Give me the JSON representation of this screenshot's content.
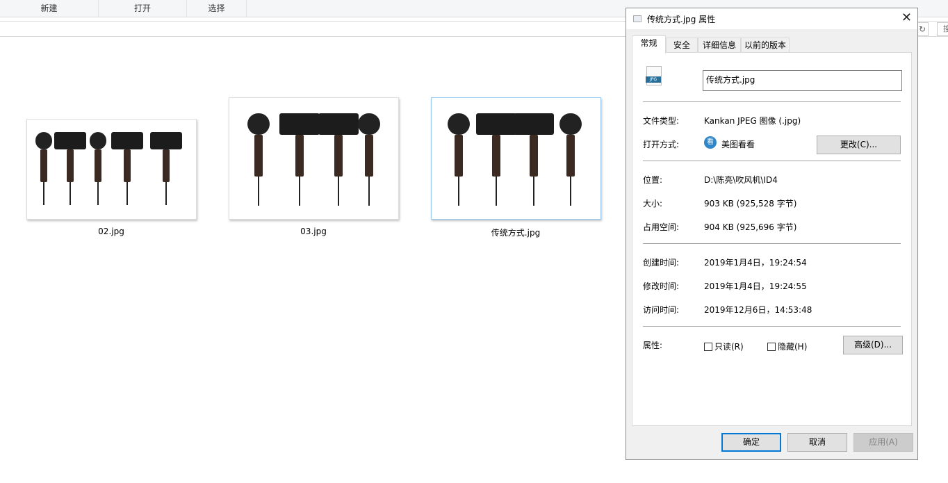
{
  "ribbon": {
    "new": "新建",
    "open": "打开",
    "select": "选择"
  },
  "search_hint": "搜",
  "files": [
    {
      "name": "02.jpg"
    },
    {
      "name": "03.jpg"
    },
    {
      "name": "传统方式.jpg"
    }
  ],
  "dialog": {
    "title": "传统方式.jpg 属性",
    "tabs": [
      "常规",
      "安全",
      "详细信息",
      "以前的版本"
    ],
    "active_tab": "常规",
    "file_icon_label": "JPG",
    "filename": "传统方式.jpg",
    "type_label": "文件类型:",
    "type_value": "Kankan JPEG 图像 (.jpg)",
    "open_label": "打开方式:",
    "open_value": "美图看看",
    "change_button": "更改(C)...",
    "location_label": "位置:",
    "location_value": "D:\\陈亮\\吹风机\\ID4",
    "size_label": "大小:",
    "size_value": "903 KB (925,528 字节)",
    "disk_label": "占用空间:",
    "disk_value": "904 KB (925,696 字节)",
    "created_label": "创建时间:",
    "created_value": "2019年1月4日，19:24:54",
    "modified_label": "修改时间:",
    "modified_value": "2019年1月4日，19:24:55",
    "accessed_label": "访问时间:",
    "accessed_value": "2019年12月6日，14:53:48",
    "attr_label": "属性:",
    "readonly": "只读(R)",
    "readonly_checked": false,
    "hidden": "隐藏(H)",
    "hidden_checked": false,
    "advanced_button": "高级(D)...",
    "ok": "确定",
    "cancel": "取消",
    "apply": "应用(A)"
  }
}
